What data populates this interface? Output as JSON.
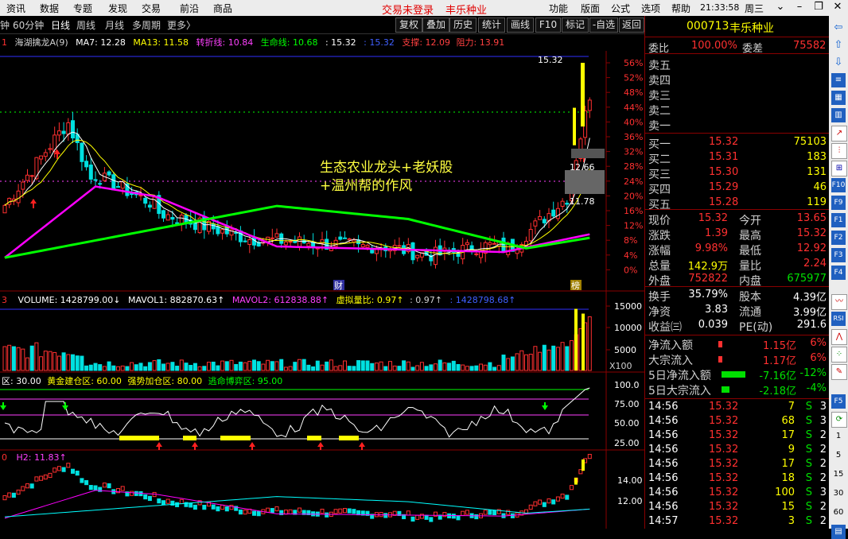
{
  "menu": {
    "items": [
      "资讯",
      "数据",
      "专题",
      "发现",
      "交易",
      "前沿",
      "商品"
    ],
    "center_status": "交易未登录",
    "center_stock": "丰乐种业",
    "right_items": [
      "功能",
      "版面",
      "公式",
      "选项",
      "帮助"
    ],
    "clock": "21:33:58",
    "weekday": "周三"
  },
  "toolbar": {
    "periods": [
      "钟",
      "60分钟",
      "日线",
      "周线",
      "月线",
      "多周期",
      "更多〉"
    ],
    "buttons": [
      "复权",
      "叠加",
      "历史",
      "统计",
      "画线",
      "F10",
      "标记",
      "-自选",
      "返回"
    ]
  },
  "price_indicators": {
    "num": "1",
    "name": "海湖擒龙A(9)",
    "ma7": "MA7: 12.28",
    "ma13": "MA13: 11.58",
    "zhuanzhe": "转折线: 10.84",
    "shengming": "生命线: 10.68",
    "val1": ": 15.32",
    "val2": ": 15.32",
    "zhicheng": "支撑: 12.09",
    "zuli": "阻力: 13.91"
  },
  "price_axis": [
    "56%",
    "52%",
    "48%",
    "44%",
    "40%",
    "36%",
    "32%",
    "28%",
    "24%",
    "20%",
    "16%",
    "12%",
    "8%",
    "4%",
    "0%"
  ],
  "price_labels": {
    "high": "15.32",
    "mid": "12.66",
    "low": "11.78",
    "badge_cai": "财",
    "badge_bang": "榜"
  },
  "annotation": {
    "line1": "生态农业龙头+老妖股",
    "line2": "+温州帮的作风"
  },
  "volume_indicators": {
    "num": "3",
    "vol": "VOLUME: 1428799.00↓",
    "mavol1": "MAVOL1: 882870.63↑",
    "mavol2": "MAVOL2: 612838.88↑",
    "ratio": "虚拟量比: 0.97↑",
    "ratio2": ": 0.97↑",
    "vol2": ": 1428798.68↑"
  },
  "volume_axis": [
    "15000",
    "10000",
    "5000"
  ],
  "volume_unit": "X100",
  "osc_indicators": {
    "zone1": "区: 30.00",
    "zone2": "黄金建仓区: 60.00",
    "zone3": "强势加仓区: 80.00",
    "zone4": "逃命博弈区: 95.00"
  },
  "osc_axis": [
    "100.0",
    "75.00",
    "50.00",
    "25.00"
  ],
  "h_indicators": {
    "num": "0",
    "h2": "H2: 11.83↑"
  },
  "h_axis": [
    "14.00",
    "12.00"
  ],
  "quote": {
    "code": "000713",
    "name": "丰乐种业",
    "weibi_label": "委比",
    "weibi": "100.00%",
    "weicha_label": "委差",
    "weicha": "75582",
    "sell": [
      "卖五",
      "卖四",
      "卖三",
      "卖二",
      "卖一"
    ],
    "buy": [
      {
        "label": "买一",
        "price": "15.32",
        "vol": "75103"
      },
      {
        "label": "买二",
        "price": "15.31",
        "vol": "183"
      },
      {
        "label": "买三",
        "price": "15.30",
        "vol": "131"
      },
      {
        "label": "买四",
        "price": "15.29",
        "vol": "46"
      },
      {
        "label": "买五",
        "price": "15.28",
        "vol": "119"
      }
    ],
    "stats": [
      {
        "l1": "现价",
        "v1": "15.32",
        "l2": "今开",
        "v2": "13.65",
        "c1": "red",
        "c2": "red"
      },
      {
        "l1": "涨跌",
        "v1": "1.39",
        "l2": "最高",
        "v2": "15.32",
        "c1": "red",
        "c2": "red"
      },
      {
        "l1": "涨幅",
        "v1": "9.98%",
        "l2": "最低",
        "v2": "12.92",
        "c1": "red",
        "c2": "red"
      },
      {
        "l1": "总量",
        "v1": "142.9万",
        "l2": "量比",
        "v2": "2.24",
        "c1": "yel",
        "c2": "red"
      },
      {
        "l1": "外盘",
        "v1": "752822",
        "l2": "内盘",
        "v2": "675977",
        "c1": "red",
        "c2": "grn"
      }
    ],
    "stats2": [
      {
        "l1": "换手",
        "v1": "35.79%",
        "l2": "股本",
        "v2": "4.39亿"
      },
      {
        "l1": "净资",
        "v1": "3.83",
        "l2": "流通",
        "v2": "3.99亿"
      },
      {
        "l1": "收益㈢",
        "v1": "0.039",
        "l2": "PE(动)",
        "v2": "291.6"
      }
    ],
    "flows": [
      {
        "label": "净流入额",
        "val": "1.15亿",
        "pct": "6%",
        "color": "red"
      },
      {
        "label": "大宗流入",
        "val": "1.17亿",
        "pct": "6%",
        "color": "red"
      },
      {
        "label": "5日净流入额",
        "val": "-7.16亿",
        "pct": "-12%",
        "color": "grn"
      },
      {
        "label": "5日大宗流入",
        "val": "-2.18亿",
        "pct": "-4%",
        "color": "grn"
      }
    ],
    "ticks": [
      {
        "t": "14:56",
        "p": "15.32",
        "v": "7",
        "s": "S",
        "n": "3"
      },
      {
        "t": "14:56",
        "p": "15.32",
        "v": "68",
        "s": "S",
        "n": "3"
      },
      {
        "t": "14:56",
        "p": "15.32",
        "v": "17",
        "s": "S",
        "n": "2"
      },
      {
        "t": "14:56",
        "p": "15.32",
        "v": "9",
        "s": "S",
        "n": "2"
      },
      {
        "t": "14:56",
        "p": "15.32",
        "v": "17",
        "s": "S",
        "n": "2"
      },
      {
        "t": "14:56",
        "p": "15.32",
        "v": "18",
        "s": "S",
        "n": "2"
      },
      {
        "t": "14:56",
        "p": "15.32",
        "v": "100",
        "s": "S",
        "n": "3"
      },
      {
        "t": "14:56",
        "p": "15.32",
        "v": "15",
        "s": "S",
        "n": "2"
      },
      {
        "t": "14:57",
        "p": "15.32",
        "v": "3",
        "s": "S",
        "n": "2"
      }
    ]
  },
  "side_toolbar": [
    "RSI",
    "F10",
    "F5",
    "30",
    "60"
  ],
  "colors": {
    "up": "#ff3030",
    "down": "#00e0e0",
    "ma7": "#ffffff",
    "ma13": "#ffff00",
    "ma_magenta": "#ff00ff",
    "ma_green": "#00ff00",
    "border": "#8a0000"
  }
}
